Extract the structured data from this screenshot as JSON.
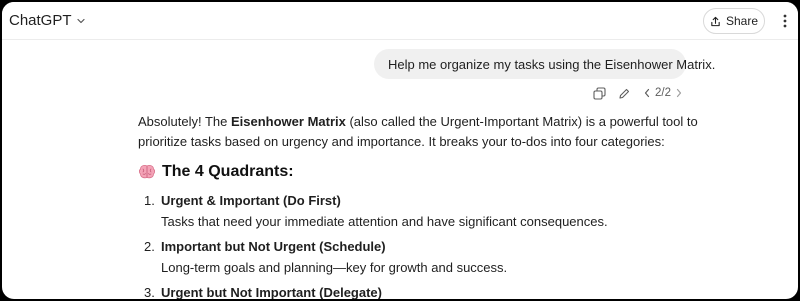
{
  "header": {
    "title": "ChatGPT",
    "share_label": "Share"
  },
  "user_message": {
    "text": "Help me organize my tasks using the Eisenhower Matrix."
  },
  "message_actions": {
    "pager": "2/2"
  },
  "reply": {
    "intro_start": "Absolutely! The ",
    "intro_bold": "Eisenhower Matrix",
    "intro_end": " (also called the Urgent-Important Matrix) is a powerful tool to prioritize tasks based on urgency and importance. It breaks your to-dos into four categories:",
    "quadrants_heading": "The 4 Quadrants:",
    "items": [
      {
        "number": "1.",
        "title": "Urgent & Important (Do First)",
        "description": "Tasks that need your immediate attention and have significant consequences."
      },
      {
        "number": "2.",
        "title": "Important but Not Urgent (Schedule)",
        "description": "Long-term goals and planning—key for growth and success."
      },
      {
        "number": "3.",
        "title": "Urgent but Not Important (Delegate)"
      }
    ]
  },
  "icons": {
    "heading_emoji": "brain-icon"
  }
}
